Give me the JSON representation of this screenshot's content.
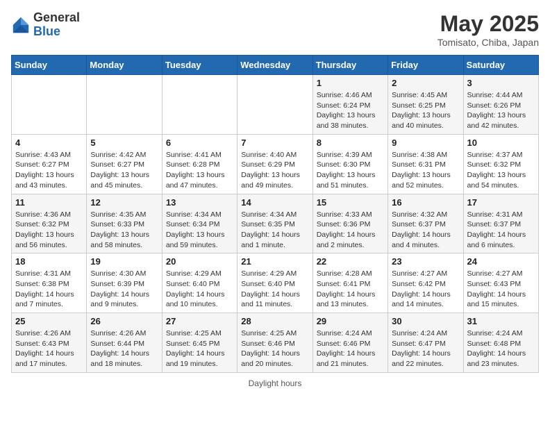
{
  "header": {
    "logo_general": "General",
    "logo_blue": "Blue",
    "month_title": "May 2025",
    "subtitle": "Tomisato, Chiba, Japan"
  },
  "days_of_week": [
    "Sunday",
    "Monday",
    "Tuesday",
    "Wednesday",
    "Thursday",
    "Friday",
    "Saturday"
  ],
  "weeks": [
    [
      {
        "day": "",
        "info": ""
      },
      {
        "day": "",
        "info": ""
      },
      {
        "day": "",
        "info": ""
      },
      {
        "day": "",
        "info": ""
      },
      {
        "day": "1",
        "info": "Sunrise: 4:46 AM\nSunset: 6:24 PM\nDaylight: 13 hours and 38 minutes."
      },
      {
        "day": "2",
        "info": "Sunrise: 4:45 AM\nSunset: 6:25 PM\nDaylight: 13 hours and 40 minutes."
      },
      {
        "day": "3",
        "info": "Sunrise: 4:44 AM\nSunset: 6:26 PM\nDaylight: 13 hours and 42 minutes."
      }
    ],
    [
      {
        "day": "4",
        "info": "Sunrise: 4:43 AM\nSunset: 6:27 PM\nDaylight: 13 hours and 43 minutes."
      },
      {
        "day": "5",
        "info": "Sunrise: 4:42 AM\nSunset: 6:27 PM\nDaylight: 13 hours and 45 minutes."
      },
      {
        "day": "6",
        "info": "Sunrise: 4:41 AM\nSunset: 6:28 PM\nDaylight: 13 hours and 47 minutes."
      },
      {
        "day": "7",
        "info": "Sunrise: 4:40 AM\nSunset: 6:29 PM\nDaylight: 13 hours and 49 minutes."
      },
      {
        "day": "8",
        "info": "Sunrise: 4:39 AM\nSunset: 6:30 PM\nDaylight: 13 hours and 51 minutes."
      },
      {
        "day": "9",
        "info": "Sunrise: 4:38 AM\nSunset: 6:31 PM\nDaylight: 13 hours and 52 minutes."
      },
      {
        "day": "10",
        "info": "Sunrise: 4:37 AM\nSunset: 6:32 PM\nDaylight: 13 hours and 54 minutes."
      }
    ],
    [
      {
        "day": "11",
        "info": "Sunrise: 4:36 AM\nSunset: 6:32 PM\nDaylight: 13 hours and 56 minutes."
      },
      {
        "day": "12",
        "info": "Sunrise: 4:35 AM\nSunset: 6:33 PM\nDaylight: 13 hours and 58 minutes."
      },
      {
        "day": "13",
        "info": "Sunrise: 4:34 AM\nSunset: 6:34 PM\nDaylight: 13 hours and 59 minutes."
      },
      {
        "day": "14",
        "info": "Sunrise: 4:34 AM\nSunset: 6:35 PM\nDaylight: 14 hours and 1 minute."
      },
      {
        "day": "15",
        "info": "Sunrise: 4:33 AM\nSunset: 6:36 PM\nDaylight: 14 hours and 2 minutes."
      },
      {
        "day": "16",
        "info": "Sunrise: 4:32 AM\nSunset: 6:37 PM\nDaylight: 14 hours and 4 minutes."
      },
      {
        "day": "17",
        "info": "Sunrise: 4:31 AM\nSunset: 6:37 PM\nDaylight: 14 hours and 6 minutes."
      }
    ],
    [
      {
        "day": "18",
        "info": "Sunrise: 4:31 AM\nSunset: 6:38 PM\nDaylight: 14 hours and 7 minutes."
      },
      {
        "day": "19",
        "info": "Sunrise: 4:30 AM\nSunset: 6:39 PM\nDaylight: 14 hours and 9 minutes."
      },
      {
        "day": "20",
        "info": "Sunrise: 4:29 AM\nSunset: 6:40 PM\nDaylight: 14 hours and 10 minutes."
      },
      {
        "day": "21",
        "info": "Sunrise: 4:29 AM\nSunset: 6:40 PM\nDaylight: 14 hours and 11 minutes."
      },
      {
        "day": "22",
        "info": "Sunrise: 4:28 AM\nSunset: 6:41 PM\nDaylight: 14 hours and 13 minutes."
      },
      {
        "day": "23",
        "info": "Sunrise: 4:27 AM\nSunset: 6:42 PM\nDaylight: 14 hours and 14 minutes."
      },
      {
        "day": "24",
        "info": "Sunrise: 4:27 AM\nSunset: 6:43 PM\nDaylight: 14 hours and 15 minutes."
      }
    ],
    [
      {
        "day": "25",
        "info": "Sunrise: 4:26 AM\nSunset: 6:43 PM\nDaylight: 14 hours and 17 minutes."
      },
      {
        "day": "26",
        "info": "Sunrise: 4:26 AM\nSunset: 6:44 PM\nDaylight: 14 hours and 18 minutes."
      },
      {
        "day": "27",
        "info": "Sunrise: 4:25 AM\nSunset: 6:45 PM\nDaylight: 14 hours and 19 minutes."
      },
      {
        "day": "28",
        "info": "Sunrise: 4:25 AM\nSunset: 6:46 PM\nDaylight: 14 hours and 20 minutes."
      },
      {
        "day": "29",
        "info": "Sunrise: 4:24 AM\nSunset: 6:46 PM\nDaylight: 14 hours and 21 minutes."
      },
      {
        "day": "30",
        "info": "Sunrise: 4:24 AM\nSunset: 6:47 PM\nDaylight: 14 hours and 22 minutes."
      },
      {
        "day": "31",
        "info": "Sunrise: 4:24 AM\nSunset: 6:48 PM\nDaylight: 14 hours and 23 minutes."
      }
    ]
  ],
  "footer": {
    "daylight_label": "Daylight hours"
  }
}
